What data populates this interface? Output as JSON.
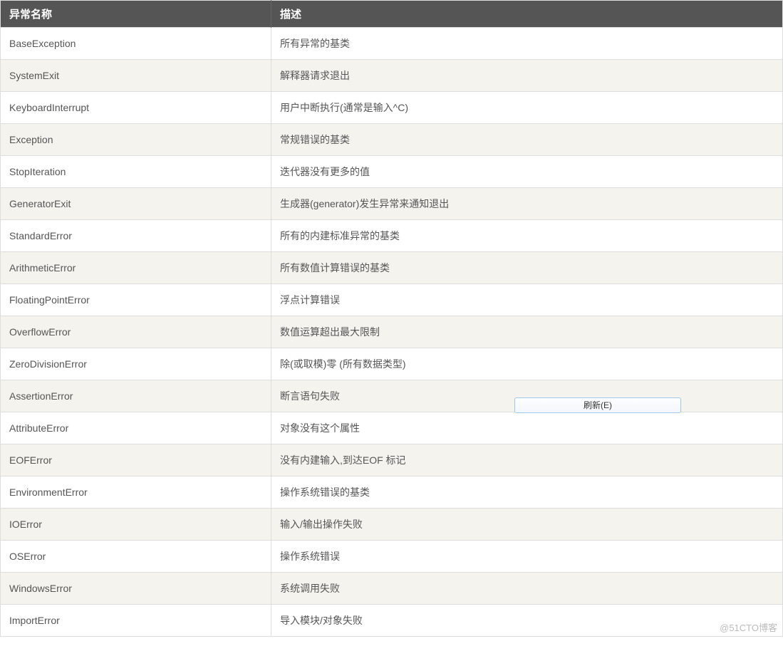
{
  "table": {
    "headers": {
      "name": "异常名称",
      "desc": "描述"
    },
    "rows": [
      {
        "name": "BaseException",
        "desc": "所有异常的基类"
      },
      {
        "name": "SystemExit",
        "desc": "解释器请求退出"
      },
      {
        "name": "KeyboardInterrupt",
        "desc": "用户中断执行(通常是输入^C)"
      },
      {
        "name": "Exception",
        "desc": "常规错误的基类"
      },
      {
        "name": "StopIteration",
        "desc": "迭代器没有更多的值"
      },
      {
        "name": "GeneratorExit",
        "desc": "生成器(generator)发生异常来通知退出"
      },
      {
        "name": "StandardError",
        "desc": "所有的内建标准异常的基类"
      },
      {
        "name": "ArithmeticError",
        "desc": "所有数值计算错误的基类"
      },
      {
        "name": "FloatingPointError",
        "desc": "浮点计算错误"
      },
      {
        "name": "OverflowError",
        "desc": "数值运算超出最大限制"
      },
      {
        "name": "ZeroDivisionError",
        "desc": "除(或取模)零 (所有数据类型)"
      },
      {
        "name": "AssertionError",
        "desc": "断言语句失败"
      },
      {
        "name": "AttributeError",
        "desc": "对象没有这个属性"
      },
      {
        "name": "EOFError",
        "desc": "没有内建输入,到达EOF 标记"
      },
      {
        "name": "EnvironmentError",
        "desc": "操作系统错误的基类"
      },
      {
        "name": "IOError",
        "desc": "输入/输出操作失败"
      },
      {
        "name": "OSError",
        "desc": "操作系统错误"
      },
      {
        "name": "WindowsError",
        "desc": "系统调用失败"
      },
      {
        "name": "ImportError",
        "desc": "导入模块/对象失败"
      }
    ]
  },
  "refresh_button": {
    "label": "刷新(E)"
  },
  "watermark": "@51CTO博客"
}
